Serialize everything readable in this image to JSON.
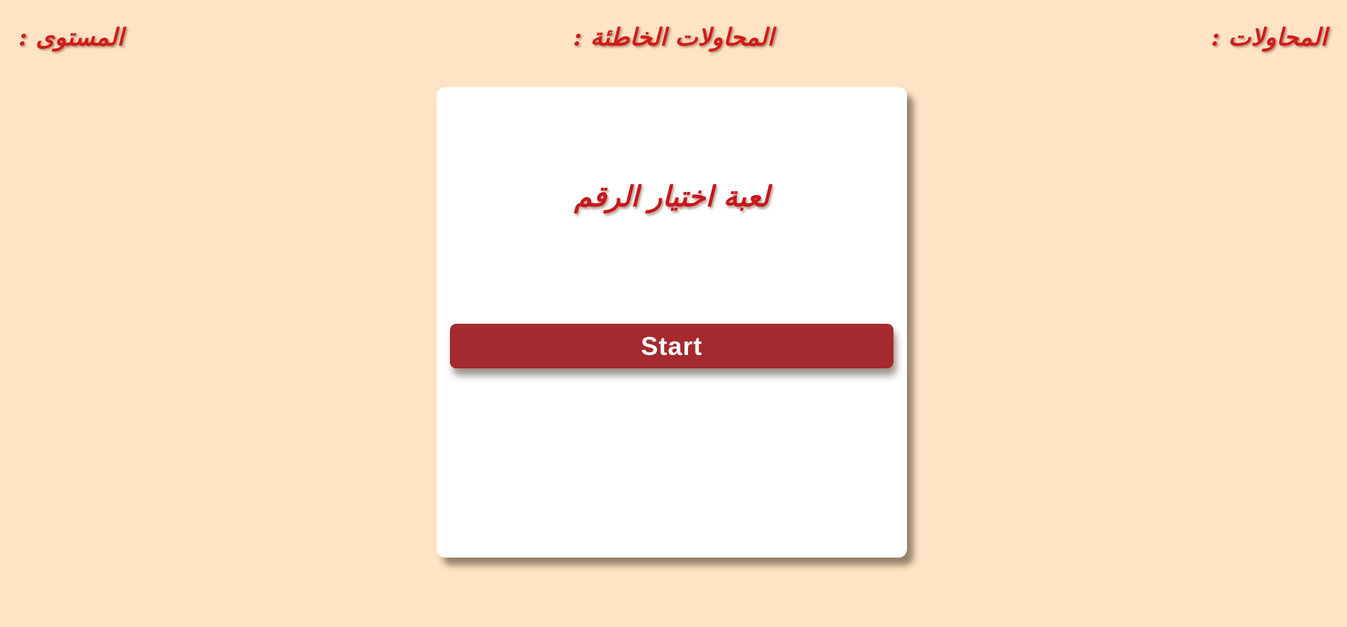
{
  "stats": {
    "attempts_label": "المحاولات :",
    "wrong_attempts_label": "المحاولات الخاطئة :",
    "level_label": "المستوى :"
  },
  "game": {
    "title": "لعبة اختيار الرقم",
    "start_label": "Start"
  },
  "colors": {
    "background": "#fee3c4",
    "label_red": "#d11a1a",
    "button": "#a52a2d",
    "card": "#ffffff"
  }
}
